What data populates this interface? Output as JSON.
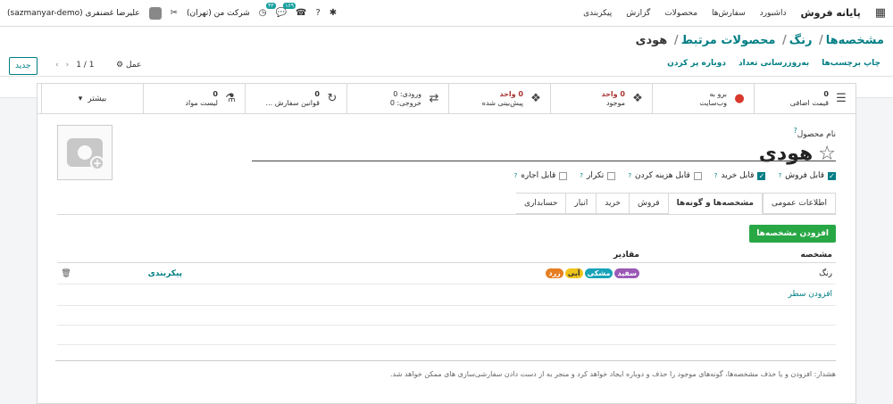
{
  "navbar": {
    "brand": "پایانه فروش",
    "menu": [
      "داشبورد",
      "سفارش‌ها",
      "محصولات",
      "گزارش",
      "پیکربندی"
    ],
    "company": "شرکت من (تهران)",
    "user": "علیرضا غضنفری (sazmanyar-demo)",
    "activity_badge": "۴۳",
    "chat_badge": "۱۶۹"
  },
  "breadcrumb": {
    "parts": [
      "مشخصه‌ها",
      "رنگ",
      "محصولات مرتبط"
    ],
    "current": "هودی"
  },
  "controls": {
    "new_label": "جدید",
    "pager": "1 / 1",
    "action_label": "عمل"
  },
  "statusbar": [
    "چاپ برچسب‌ها",
    "به‌روزرسانی تعداد",
    "دوباره پر کردن"
  ],
  "smart_buttons": [
    {
      "icon": "list-icon",
      "value": "0",
      "label": "قیمت اضافی"
    },
    {
      "icon": "globe-icon",
      "value": "برو به",
      "label": "وب‌سایت"
    },
    {
      "icon": "cubes-icon",
      "value": "0 واحد",
      "label": "موجود"
    },
    {
      "icon": "cubes-icon",
      "value": "0 واحد",
      "label": "پیش‌بینی شده"
    },
    {
      "icon": "exchange-icon",
      "value": "ورودی: 0",
      "label": "خروجی: 0"
    },
    {
      "icon": "refresh-icon",
      "value": "0",
      "label": "قوانین سفارش ..."
    },
    {
      "icon": "flask-icon",
      "value": "0",
      "label": "لیست مواد"
    }
  ],
  "more_label": "بیشتر",
  "product": {
    "name_label": "نام محصول",
    "name": "هودی"
  },
  "checkboxes": [
    {
      "label": "قابل فروش",
      "checked": true
    },
    {
      "label": "قابل خرید",
      "checked": true
    },
    {
      "label": "قابل هزینه کردن",
      "checked": false
    },
    {
      "label": "تکرار",
      "checked": false
    },
    {
      "label": "قابل اجاره",
      "checked": false
    }
  ],
  "tabs": [
    "اطلاعات عمومی",
    "مشخصه‌ها و گونه‌ها",
    "فروش",
    "خرید",
    "انبار",
    "حسابداری"
  ],
  "add_attribute_label": "افزودن مشخصه‌ها",
  "table": {
    "col_attribute": "مشخصه",
    "col_values": "مقادیر",
    "rows": [
      {
        "attribute": "رنگ",
        "values": [
          {
            "label": "سفید",
            "color": "#9b59b6"
          },
          {
            "label": "مشکی",
            "color": "#17a2b8"
          },
          {
            "label": "آبی",
            "color": "#f0c419"
          },
          {
            "label": "زرد",
            "color": "#e67e22"
          }
        ],
        "config": "پیکربندی"
      }
    ],
    "add_line": "افزودن سطر"
  },
  "hint": "هشدار: افزودن و یا حذف مشخصه‌ها، گونه‌های موجود را حذف و دوباره ایجاد خواهد کرد و منجر به از دست دادن سفارشی‌سازی های ممکن خواهد شد."
}
